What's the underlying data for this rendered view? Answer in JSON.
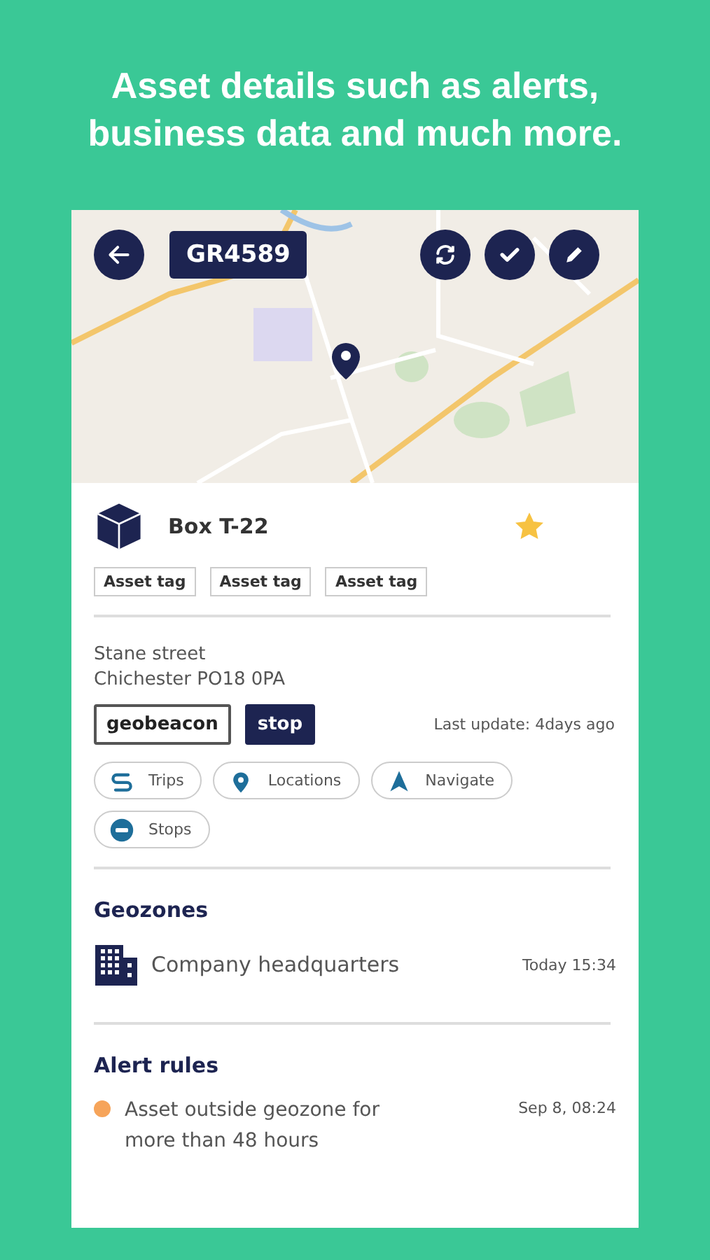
{
  "headline": "Asset details such as  alerts, business data and much more.",
  "map": {
    "kind": "picture",
    "asset_code": "GR4589"
  },
  "asset": {
    "name": "Box T-22",
    "favorite": true,
    "tags": [
      "Asset tag",
      "Asset tag",
      "Asset tag"
    ]
  },
  "address": [
    "Stane street",
    "Chichester PO18 0PA"
  ],
  "badges": [
    {
      "label": "geobeacon",
      "kind": "outline"
    },
    {
      "label": "stop",
      "kind": "filled"
    }
  ],
  "last_update": "Last update: 4days ago",
  "actions": [
    {
      "label": "Trips",
      "kind": "trips"
    },
    {
      "label": "Locations",
      "kind": "locations"
    },
    {
      "label": "Navigate",
      "kind": "navigate"
    },
    {
      "label": "Stops",
      "kind": "stops"
    }
  ],
  "geozones": {
    "title": "Geozones",
    "items": [
      {
        "name": "Company headquarters",
        "time": "Today 15:34"
      }
    ]
  },
  "alert_rules": {
    "title": "Alert rules",
    "items": [
      {
        "text": "Asset outside geozone for more than 48 hours",
        "time": "Sep 8, 08:24",
        "color": "#f6a45a"
      }
    ]
  }
}
